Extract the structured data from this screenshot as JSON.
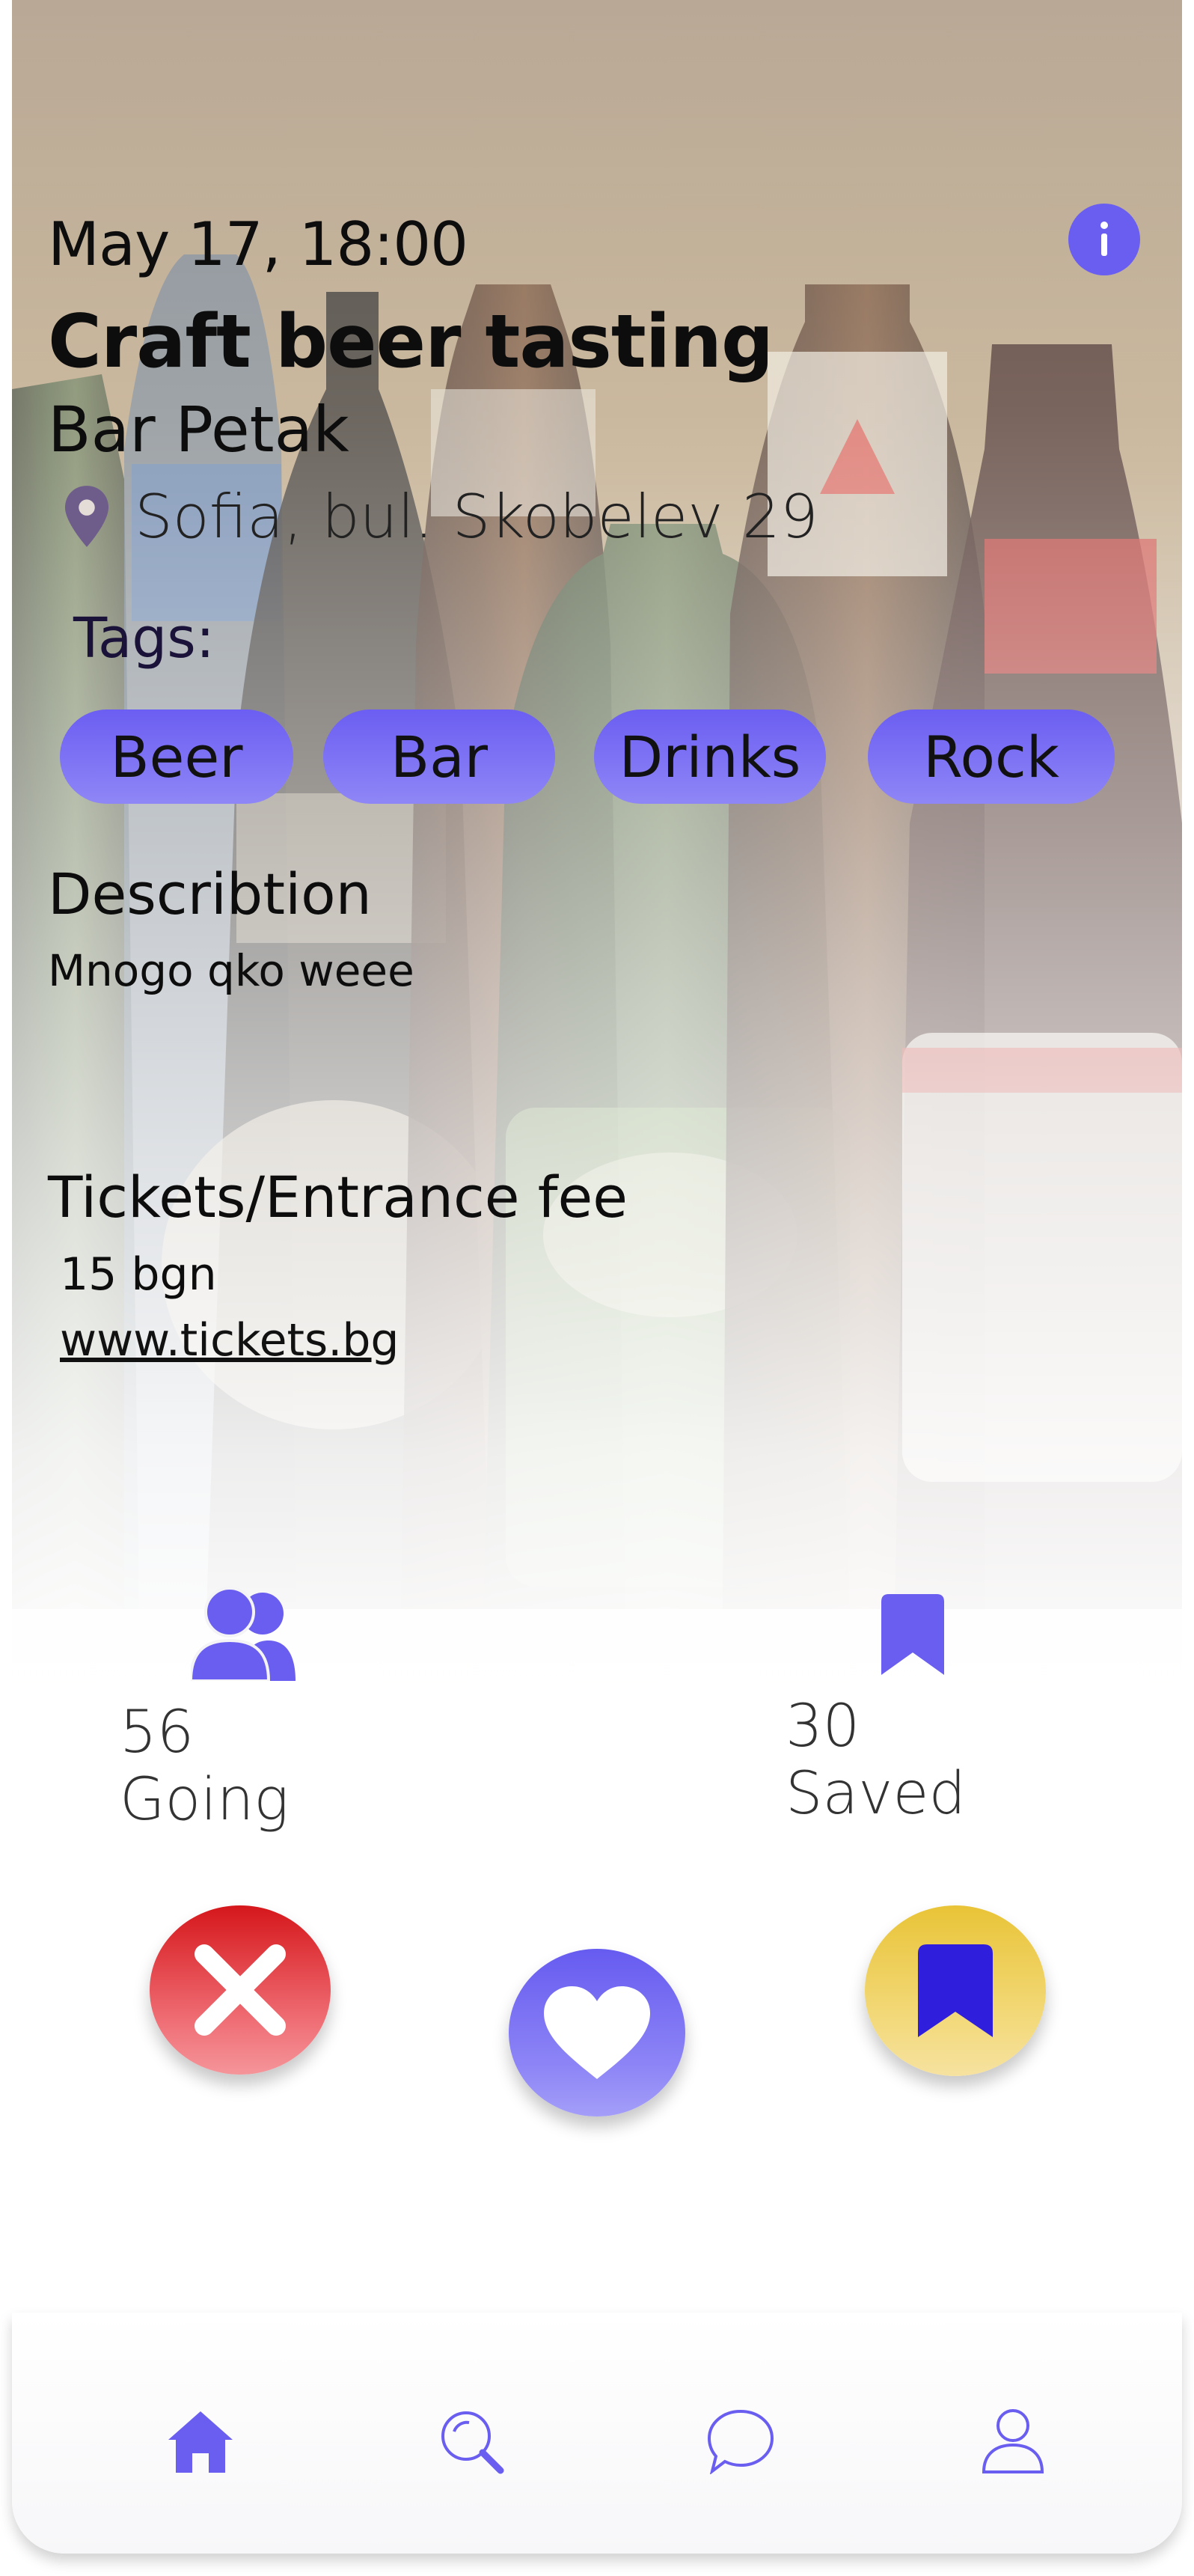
{
  "event": {
    "date": "May 17, 18:00",
    "title": "Craft beer tasting",
    "venue": "Bar Petak",
    "address": "Sofia, bul. Skobelev 29"
  },
  "tags": {
    "label": "Tags:",
    "items": [
      "Beer",
      "Bar",
      "Drinks",
      "Rock"
    ]
  },
  "description": {
    "heading": "Describtion",
    "text": "Mnogo qko weee"
  },
  "tickets": {
    "heading": "Tickets/Entrance fee",
    "price": "15 bgn",
    "link": "www.tickets.bg"
  },
  "stats": {
    "going": "56 Going",
    "saved": "30 Saved"
  },
  "icons": {
    "info": "info-icon",
    "pin": "location-pin-icon",
    "going": "users-icon",
    "saved": "bookmark-icon",
    "reject": "close-icon",
    "like": "heart-icon",
    "save": "bookmark-icon",
    "nav": [
      "home-icon",
      "search-icon",
      "chat-icon",
      "profile-icon"
    ]
  },
  "colors": {
    "accent": "#6a5ef0",
    "reject": "#e0353a",
    "save": "#efd060",
    "save_icon": "#2f1fdc"
  }
}
